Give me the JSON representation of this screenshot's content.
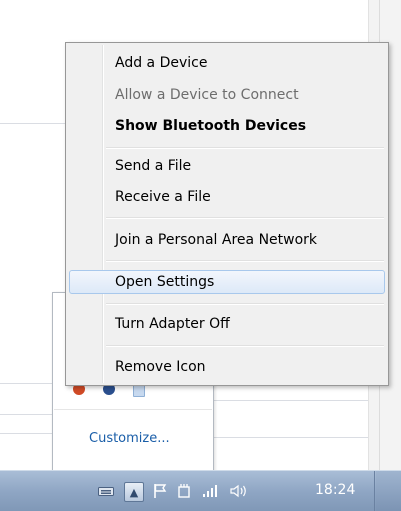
{
  "context_menu": {
    "items": [
      {
        "label": "Add a Device",
        "state": "normal"
      },
      {
        "label": "Allow a Device to Connect",
        "state": "disabled"
      },
      {
        "label": "Show Bluetooth Devices",
        "state": "default"
      },
      {
        "label": "Send a File",
        "state": "normal"
      },
      {
        "label": "Receive a File",
        "state": "normal"
      },
      {
        "label": "Join a Personal Area Network",
        "state": "normal"
      },
      {
        "label": "Open Settings",
        "state": "hover"
      },
      {
        "label": "Turn Adapter Off",
        "state": "normal"
      },
      {
        "label": "Remove Icon",
        "state": "normal"
      }
    ]
  },
  "overflow_flyout": {
    "customize_label": "Customize..."
  },
  "taskbar": {
    "clock": "18:24",
    "tray_icons": [
      "keyboard-icon",
      "show-hidden-icons-button",
      "action-center-flag-icon",
      "network-device-icon",
      "signal-bars-icon",
      "volume-icon"
    ]
  },
  "colors": {
    "taskbar": "#8fa6c4",
    "menu_background": "#f0f0f0",
    "hover_border": "#a8c8ec",
    "link": "#1a5ea8"
  }
}
